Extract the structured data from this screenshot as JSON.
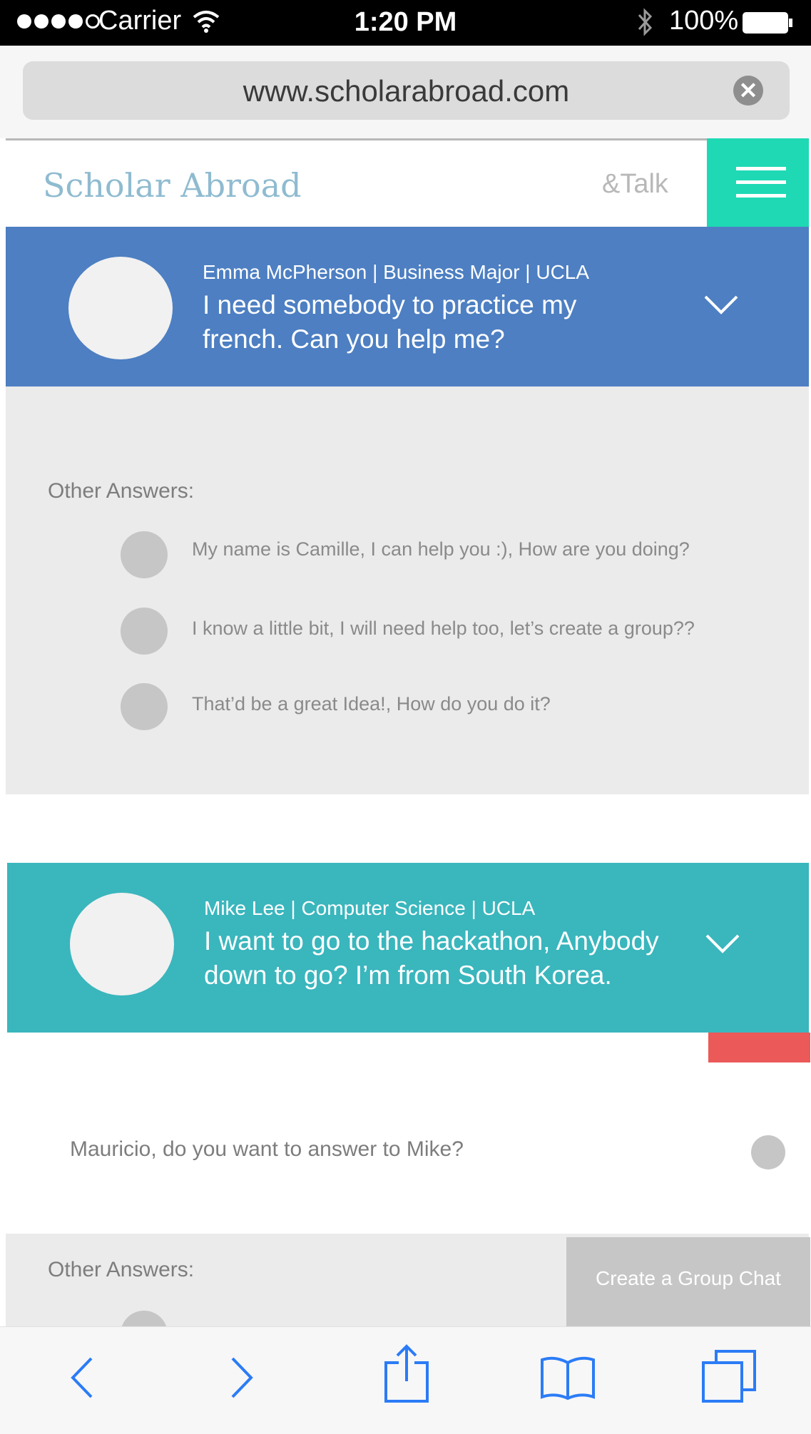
{
  "status_bar": {
    "carrier": "Carrier",
    "time": "1:20 PM",
    "battery_percent": "100%"
  },
  "browser": {
    "url": "www.scholarabroad.com"
  },
  "header": {
    "logo": "Scholar Abroad",
    "talk_link": "&Talk"
  },
  "questions": [
    {
      "meta": "Emma McPherson | Business Major | UCLA",
      "text": "I need somebody to practice my french. Can you help me?",
      "color": "#4d7fc2"
    },
    {
      "meta": "Mike Lee | Computer Science | UCLA",
      "text": "I want to go to the hackathon, Anybody down to go? I’m from South Korea.",
      "color": "#3ab6bd"
    }
  ],
  "answers_section_1": {
    "title": "Other Answers:",
    "items": [
      "My name is Camille, I can help you :), How are you doing?",
      "I know a little bit, I will need help too, let’s create a group??",
      "That’d be a great Idea!, How do you do it?"
    ]
  },
  "prompt": {
    "text": "Mauricio, do you want to answer to Mike?"
  },
  "answers_section_2": {
    "title": "Other Answers:"
  },
  "create_group_button": "Create a Group Chat",
  "accents": {
    "menu": "#1ed9b4",
    "red_tab": "#ec5959"
  }
}
